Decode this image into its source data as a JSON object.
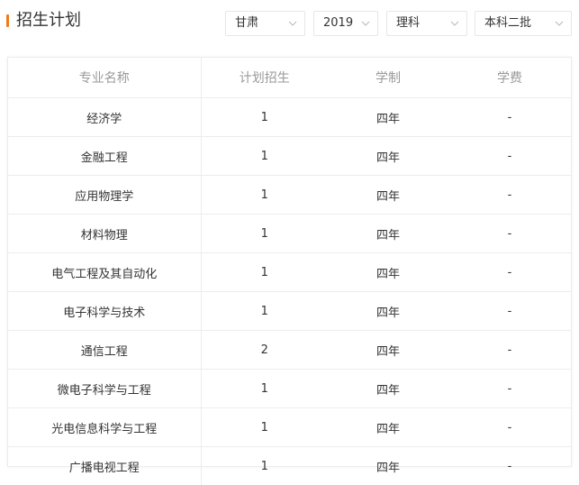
{
  "header": {
    "title": "招生计划"
  },
  "filters": {
    "province": "甘肃",
    "year": "2019",
    "subject": "理科",
    "batch": "本科二批"
  },
  "table": {
    "columns": [
      "专业名称",
      "计划招生",
      "学制",
      "学费"
    ],
    "rows": [
      [
        "经济学",
        "1",
        "四年",
        "-"
      ],
      [
        "金融工程",
        "1",
        "四年",
        "-"
      ],
      [
        "应用物理学",
        "1",
        "四年",
        "-"
      ],
      [
        "材料物理",
        "1",
        "四年",
        "-"
      ],
      [
        "电气工程及其自动化",
        "1",
        "四年",
        "-"
      ],
      [
        "电子科学与技术",
        "1",
        "四年",
        "-"
      ],
      [
        "通信工程",
        "2",
        "四年",
        "-"
      ],
      [
        "微电子科学与工程",
        "1",
        "四年",
        "-"
      ],
      [
        "光电信息科学与工程",
        "1",
        "四年",
        "-"
      ],
      [
        "广播电视工程",
        "1",
        "四年",
        "-"
      ]
    ]
  },
  "colors": {
    "accent": "#f07a1a",
    "border": "#ececec",
    "header_text": "#999999"
  },
  "icons": {
    "dropdown": "chevron-down-icon"
  }
}
